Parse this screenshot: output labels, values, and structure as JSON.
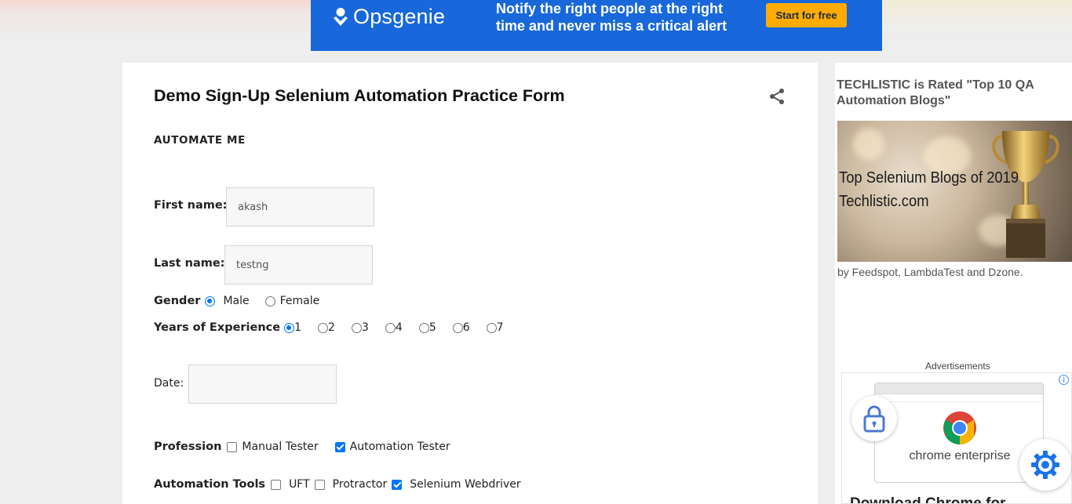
{
  "banner_ad": {
    "brand": "Opsgenie",
    "headline": "Notify the right people at the right time and never miss a critical alert",
    "cta_label": "Start for free",
    "bg_color": "#1868db",
    "cta_color": "#ffab00"
  },
  "post": {
    "title": "Demo Sign-Up Selenium Automation Practice Form",
    "section_label": "AUTOMATE ME",
    "share_icon": "share-icon"
  },
  "form": {
    "first_name": {
      "label": "First name:",
      "value": "akash"
    },
    "last_name": {
      "label": "Last name:",
      "value": "testng"
    },
    "gender": {
      "label": "Gender",
      "options": [
        {
          "label": "Male",
          "checked": true
        },
        {
          "label": "Female",
          "checked": false
        }
      ]
    },
    "experience": {
      "label": "Years of Experience",
      "options": [
        {
          "label": "1",
          "checked": true
        },
        {
          "label": "2",
          "checked": false
        },
        {
          "label": "3",
          "checked": false
        },
        {
          "label": "4",
          "checked": false
        },
        {
          "label": "5",
          "checked": false
        },
        {
          "label": "6",
          "checked": false
        },
        {
          "label": "7",
          "checked": false
        }
      ]
    },
    "date": {
      "label": "Date:",
      "value": ""
    },
    "profession": {
      "label": "Profession",
      "options": [
        {
          "label": "Manual Tester",
          "checked": false
        },
        {
          "label": "Automation Tester",
          "checked": true
        }
      ]
    },
    "tools": {
      "label": "Automation Tools",
      "options": [
        {
          "label": "UFT",
          "checked": false
        },
        {
          "label": "Protractor",
          "checked": false
        },
        {
          "label": "Selenium Webdriver",
          "checked": true
        }
      ]
    },
    "accent_color": "#0075ff"
  },
  "sidebar": {
    "title": "TECHLISTIC is Rated \"Top 10 QA Automation Blogs\"",
    "promo_line1": "Top Selenium Blogs of 2019",
    "promo_line2": "Techlistic.com",
    "byline": "by Feedspot, LambdaTest and Dzone.",
    "ads_label": "Advertisements",
    "ad": {
      "product": "chrome enterprise",
      "headline": "Download Chrome for"
    }
  }
}
